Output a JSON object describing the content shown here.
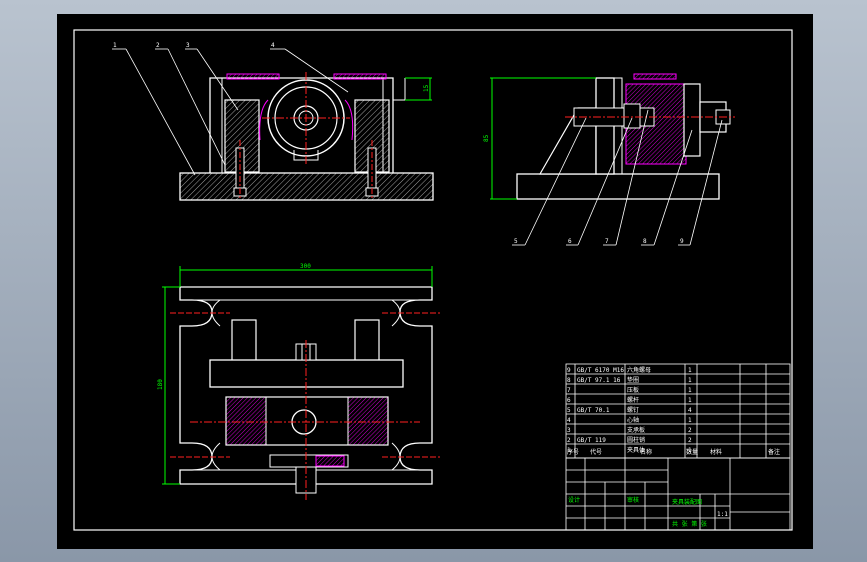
{
  "colors": {
    "outline": "#ffffff",
    "hatch": "#c8c8c8",
    "centerline": "#ff2020",
    "dimension": "#00ff00",
    "magenta": "#ff00ff",
    "leader": "#ffffff",
    "frame": "#ffffff"
  },
  "balloons": {
    "b1": "1",
    "b2": "2",
    "b3": "3",
    "b4": "4",
    "b5": "5",
    "b6": "6",
    "b7": "7",
    "b8": "8",
    "b9": "9"
  },
  "dimensions": {
    "top_width": "300",
    "left_height": "180",
    "side_height": "85",
    "top_right": "15"
  },
  "bom": {
    "rows": [
      {
        "no": "9",
        "code": "GB/T 6170 M16",
        "name": "六角螺母",
        "qty": "1"
      },
      {
        "no": "8",
        "code": "GB/T 97.1 16",
        "name": "垫圈",
        "qty": "1"
      },
      {
        "no": "7",
        "code": "",
        "name": "压板",
        "qty": "1"
      },
      {
        "no": "6",
        "code": "",
        "name": "螺杆",
        "qty": "1"
      },
      {
        "no": "5",
        "code": "GB/T 70.1",
        "name": "螺钉",
        "qty": "4"
      },
      {
        "no": "4",
        "code": "",
        "name": "心轴",
        "qty": "1"
      },
      {
        "no": "3",
        "code": "",
        "name": "支承板",
        "qty": "2"
      },
      {
        "no": "2",
        "code": "GB/T 119",
        "name": "圆柱销",
        "qty": "2"
      },
      {
        "no": "1",
        "code": "",
        "name": "夹具体",
        "qty": "1"
      }
    ],
    "header": [
      "序号",
      "代号",
      "名称",
      "数量",
      "材料",
      "备注"
    ]
  },
  "title_block": {
    "school": "",
    "drawing_name": "夹具装配图",
    "designer": "设计",
    "checker": "审核",
    "scale": "1:1",
    "sheet": "共 张 第 张"
  }
}
